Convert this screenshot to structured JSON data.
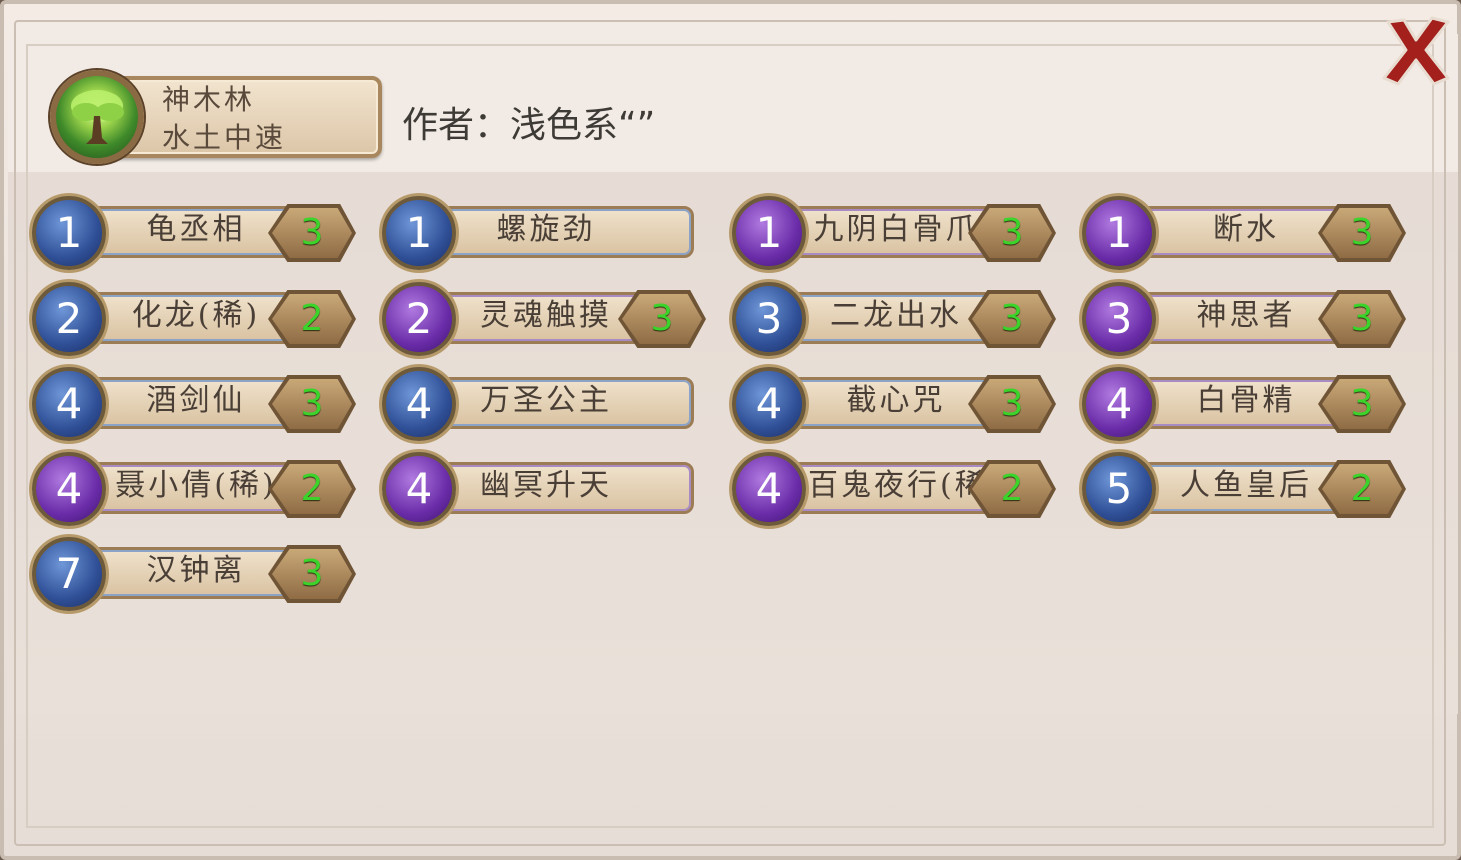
{
  "deck": {
    "name": "神木林",
    "tags": "水土中速",
    "icon": "tree-icon"
  },
  "author": "作者：浅色系“”",
  "close_icon": "close-x-icon",
  "cards": [
    {
      "cost": "1",
      "name": "龟丞相",
      "count": "3",
      "color": "blue"
    },
    {
      "cost": "1",
      "name": "螺旋劲",
      "count": "",
      "color": "blue"
    },
    {
      "cost": "1",
      "name": "九阴白骨爪",
      "count": "3",
      "color": "purple"
    },
    {
      "cost": "1",
      "name": "断水",
      "count": "3",
      "color": "purple"
    },
    {
      "cost": "2",
      "name": "化龙(稀)",
      "count": "2",
      "color": "blue"
    },
    {
      "cost": "2",
      "name": "灵魂触摸",
      "count": "3",
      "color": "purple"
    },
    {
      "cost": "3",
      "name": "二龙出水",
      "count": "3",
      "color": "blue"
    },
    {
      "cost": "3",
      "name": "神思者",
      "count": "3",
      "color": "purple"
    },
    {
      "cost": "4",
      "name": "酒剑仙",
      "count": "3",
      "color": "blue"
    },
    {
      "cost": "4",
      "name": "万圣公主",
      "count": "",
      "color": "blue"
    },
    {
      "cost": "4",
      "name": "截心咒",
      "count": "3",
      "color": "blue"
    },
    {
      "cost": "4",
      "name": "白骨精",
      "count": "3",
      "color": "purple"
    },
    {
      "cost": "4",
      "name": "聂小倩(稀)",
      "count": "2",
      "color": "purple"
    },
    {
      "cost": "4",
      "name": "幽冥升天",
      "count": "",
      "color": "purple"
    },
    {
      "cost": "4",
      "name": "百鬼夜行(稀)",
      "count": "2",
      "color": "purple"
    },
    {
      "cost": "5",
      "name": "人鱼皇后",
      "count": "2",
      "color": "blue"
    },
    {
      "cost": "7",
      "name": "汉钟离",
      "count": "3",
      "color": "blue"
    }
  ]
}
